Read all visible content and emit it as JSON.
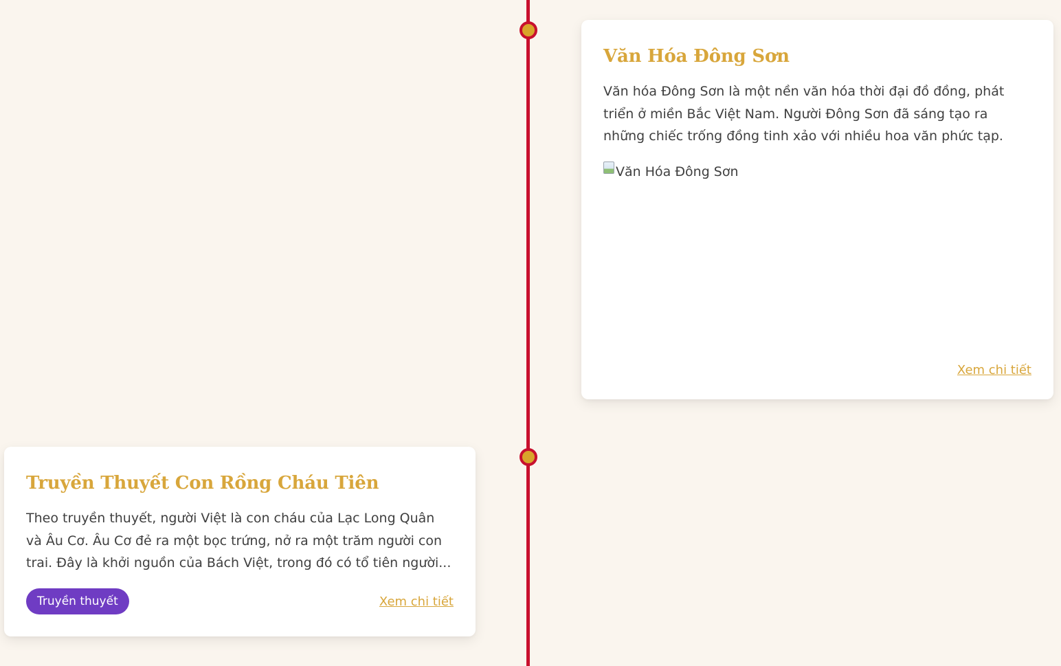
{
  "timeline": {
    "events": [
      {
        "title": "Văn Hóa Đông Sơn",
        "description": "Văn hóa Đông Sơn là một nền văn hóa thời đại đồ đồng, phát triển ở miền Bắc Việt Nam. Người Đông Sơn đã sáng tạo ra những chiếc trống đồng tinh xảo với nhiều hoa văn phức tạp.",
        "image_alt": "Văn Hóa Đông Sơn",
        "link_label": "Xem chi tiết"
      },
      {
        "title": "Truyền Thuyết Con Rồng Cháu Tiên",
        "description": "Theo truyền thuyết, người Việt là con cháu của Lạc Long Quân và Âu Cơ. Âu Cơ đẻ ra một bọc trứng, nở ra một trăm người con trai. Đây là khởi nguồn của Bách Việt, trong đó có tổ tiên người...",
        "tag": "Truyền thuyết",
        "link_label": "Xem chi tiết"
      }
    ]
  },
  "colors": {
    "background": "#faf5ee",
    "timeline_line": "#c8102e",
    "dot_fill": "#d9a52b",
    "title": "#d8a63b",
    "tag_bg": "#6f3cc3"
  },
  "icons": {
    "broken_image": "broken-image-icon"
  }
}
